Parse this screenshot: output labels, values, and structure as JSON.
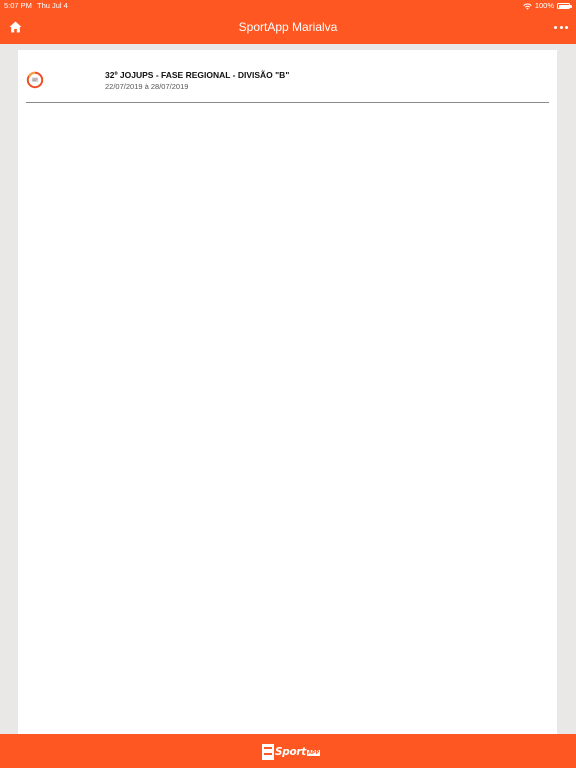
{
  "status_bar": {
    "time": "5:07 PM",
    "date": "Thu Jul 4",
    "battery": "100%"
  },
  "nav": {
    "title": "SportApp Marialva",
    "home_icon": "home-icon",
    "more_icon": "ellipsis-icon"
  },
  "events": [
    {
      "title": "32º JOJUPS - FASE REGIONAL - DIVISÃO \"B\"",
      "dates": "22/07/2019 à 28/07/2019"
    }
  ],
  "footer": {
    "logo_text": "Sport",
    "logo_suffix": "APP"
  },
  "colors": {
    "accent": "#ff5722",
    "background": "#e9e8e6",
    "card": "#ffffff"
  }
}
